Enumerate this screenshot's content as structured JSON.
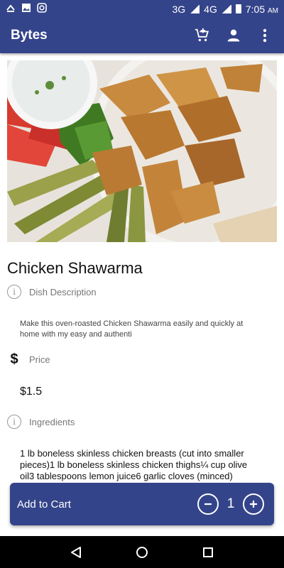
{
  "status_bar": {
    "network_3g": "3G",
    "network_4g": "4G",
    "time": "7:05",
    "ampm": "AM",
    "icons": [
      "notification-icon",
      "image-icon",
      "instagram-icon",
      "signal-icon",
      "battery-icon"
    ]
  },
  "app_bar": {
    "title": "Bytes",
    "actions": [
      "add-cart-icon",
      "account-icon",
      "more-vert-icon"
    ]
  },
  "dish": {
    "name": "Chicken Shawarma",
    "image_icon": "dish-photo"
  },
  "description": {
    "label": "Dish Description",
    "text": "Make this oven-roasted Chicken Shawarma easily and quickly at home with my easy and authenti"
  },
  "price": {
    "label": "Price",
    "value": "$1.5"
  },
  "ingredients": {
    "label": "Ingredients",
    "text": "1 lb boneless skinless chicken breasts (cut into smaller pieces)1 lb boneless skinless chicken thighs¼ cup olive oil3 tablespoons lemon juice6 garlic cloves (minced)"
  },
  "cart": {
    "label": "Add to Cart",
    "quantity": "1",
    "decrement_icon": "minus-circle-icon",
    "increment_icon": "plus-circle-icon"
  },
  "nav_bar": [
    "back-icon",
    "home-icon",
    "recents-icon"
  ],
  "colors": {
    "primary": "#34448a",
    "text": "#111111",
    "muted": "#777777"
  }
}
